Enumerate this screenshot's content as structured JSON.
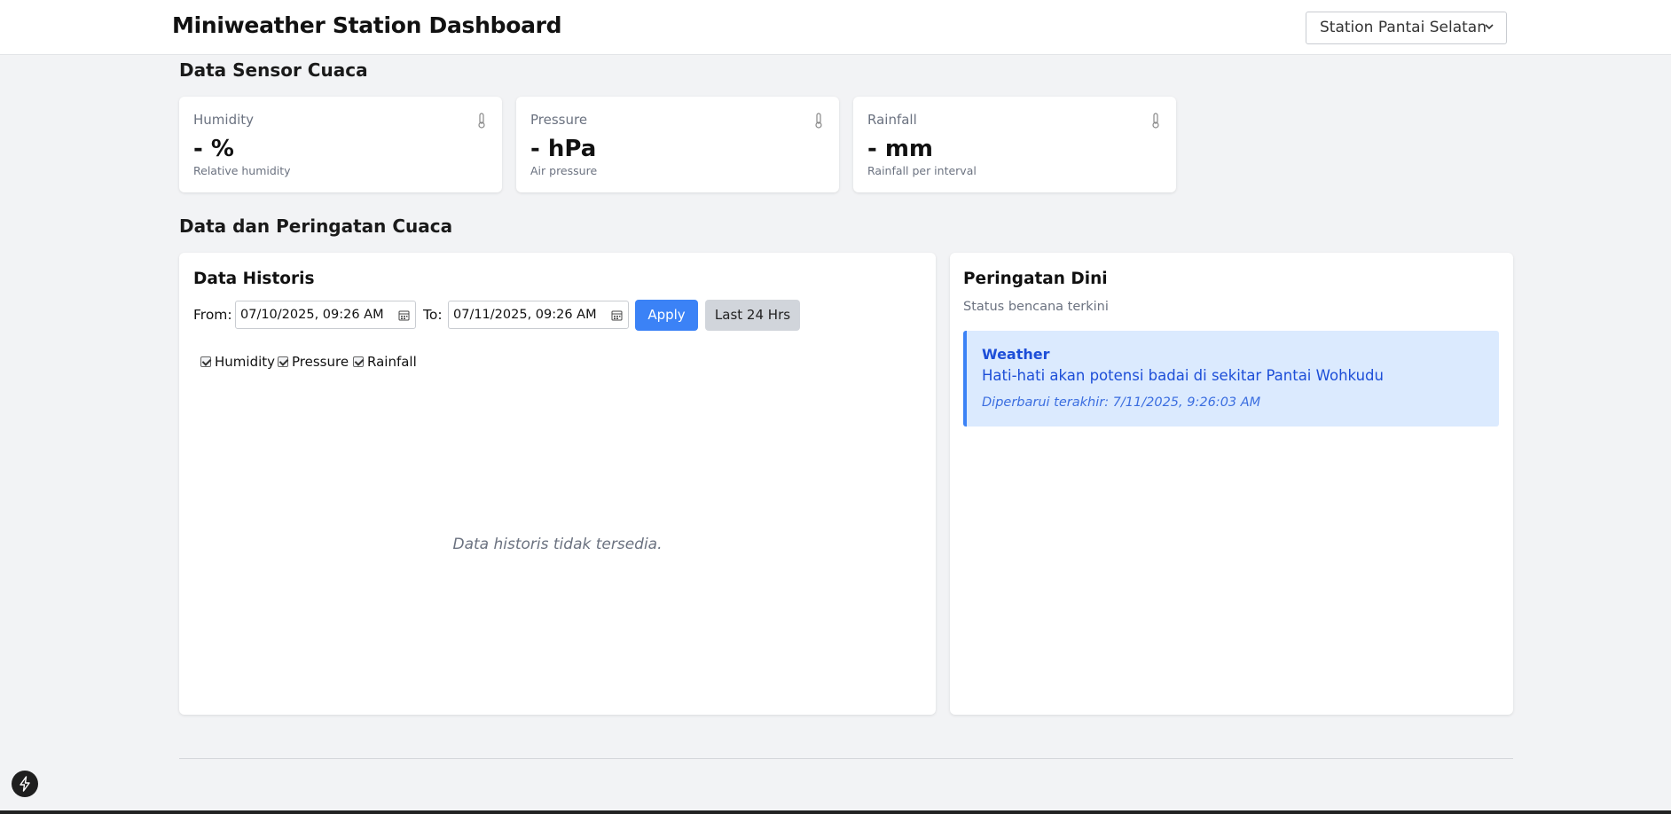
{
  "header": {
    "title": "Miniweather Station Dashboard",
    "station_selected": "Station Pantai Selatan"
  },
  "sensors": {
    "section_title": "Data Sensor Cuaca",
    "cards": [
      {
        "label": "Humidity",
        "value": "- %",
        "desc": "Relative humidity",
        "icon": "thermometer-icon"
      },
      {
        "label": "Pressure",
        "value": "- hPa",
        "desc": "Air pressure",
        "icon": "thermometer-icon"
      },
      {
        "label": "Rainfall",
        "value": "- mm",
        "desc": "Rainfall per interval",
        "icon": "thermometer-icon"
      }
    ]
  },
  "weather": {
    "section_title": "Data dan Peringatan Cuaca",
    "history": {
      "title": "Data Historis",
      "from_label": "From:",
      "from_value": "07/10/2025, 09:26 AM",
      "to_label": "To:",
      "to_value": "07/11/2025, 09:26 AM",
      "apply_label": "Apply",
      "last24_label": "Last 24 Hrs",
      "series": [
        {
          "label": "Humidity",
          "checked": true
        },
        {
          "label": "Pressure",
          "checked": true
        },
        {
          "label": "Rainfall",
          "checked": true
        }
      ],
      "empty_message": "Data historis tidak tersedia."
    },
    "warning": {
      "title": "Peringatan Dini",
      "subtitle": "Status bencana terkini",
      "alert_title": "Weather",
      "alert_message": "Hati-hati akan potensi badai di sekitar Pantai Wohkudu",
      "alert_updated": "Diperbarui terakhir: 7/11/2025, 9:26:03 AM",
      "accent": "#3b82f6"
    }
  }
}
